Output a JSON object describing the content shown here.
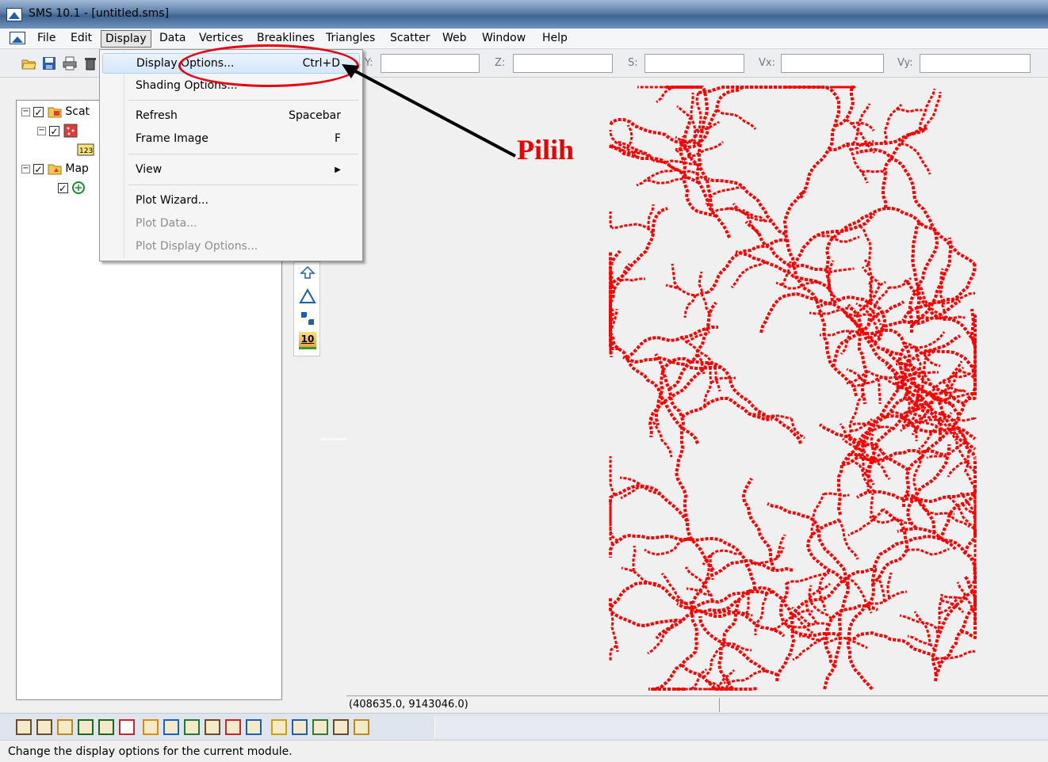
{
  "window": {
    "title": "SMS 10.1 - [untitled.sms]"
  },
  "menubar": {
    "items": [
      "File",
      "Edit",
      "Display",
      "Data",
      "Vertices",
      "Breaklines",
      "Triangles",
      "Scatter",
      "Web",
      "Window",
      "Help"
    ],
    "active": "Display"
  },
  "toolbar": {
    "coords": [
      {
        "label": "Y:",
        "value": ""
      },
      {
        "label": "Z:",
        "value": ""
      },
      {
        "label": "S:",
        "value": ""
      },
      {
        "label": "Vx:",
        "value": ""
      },
      {
        "label": "Vy:",
        "value": ""
      }
    ],
    "icons": [
      "open-icon",
      "save-icon",
      "print-icon",
      "delete-icon"
    ]
  },
  "display_menu": {
    "items": [
      {
        "label": "Display Options...",
        "shortcut": "Ctrl+D",
        "enabled": true
      },
      {
        "label": "Shading Options...",
        "shortcut": "",
        "enabled": true
      },
      {
        "label": "Refresh",
        "shortcut": "Spacebar",
        "enabled": true
      },
      {
        "label": "Frame Image",
        "shortcut": "F",
        "enabled": true
      },
      {
        "label": "View",
        "shortcut": "",
        "enabled": true,
        "submenu": true
      },
      {
        "label": "Plot Wizard...",
        "shortcut": "",
        "enabled": true
      },
      {
        "label": "Plot Data...",
        "shortcut": "",
        "enabled": false
      },
      {
        "label": "Plot Display Options...",
        "shortcut": "",
        "enabled": false
      }
    ]
  },
  "tree": {
    "nodes": [
      {
        "label": "Scat",
        "icon": "scatter-folder-icon",
        "checked": true
      },
      {
        "label": "",
        "icon": "scatter-set-icon",
        "checked": true
      },
      {
        "label": "",
        "icon": "dataset-123-icon"
      },
      {
        "label": "Map",
        "icon": "map-folder-icon",
        "checked": true
      },
      {
        "label": "",
        "icon": "coverage-icon",
        "checked": true
      }
    ]
  },
  "toolbox": {
    "icons": [
      "select-vertex-icon",
      "create-triangle-icon",
      "scatter-tool-icon",
      "contour-10-icon"
    ],
    "contour_label": "10"
  },
  "status": {
    "coordinates": "(408635.0, 9143046.0)",
    "message": "Change the display options for the current module."
  },
  "annotation": {
    "label": "Pilih",
    "color": "#e60012"
  },
  "bottom_toolbar": {
    "icons": [
      "mesh-module-icon",
      "mesh-2-icon",
      "mesh-3-icon",
      "grid-icon",
      "grid-2-icon",
      "scatter-module-icon",
      "map-module-icon",
      "gis-module-icon",
      "particle-icon",
      "generic-model-icon",
      "river-icon",
      "time-icon",
      "light-icon",
      "shading-icon",
      "display-icon",
      "properties-icon",
      "plot-icon"
    ]
  },
  "canvas": {
    "stroke_color": "#ff0000"
  }
}
